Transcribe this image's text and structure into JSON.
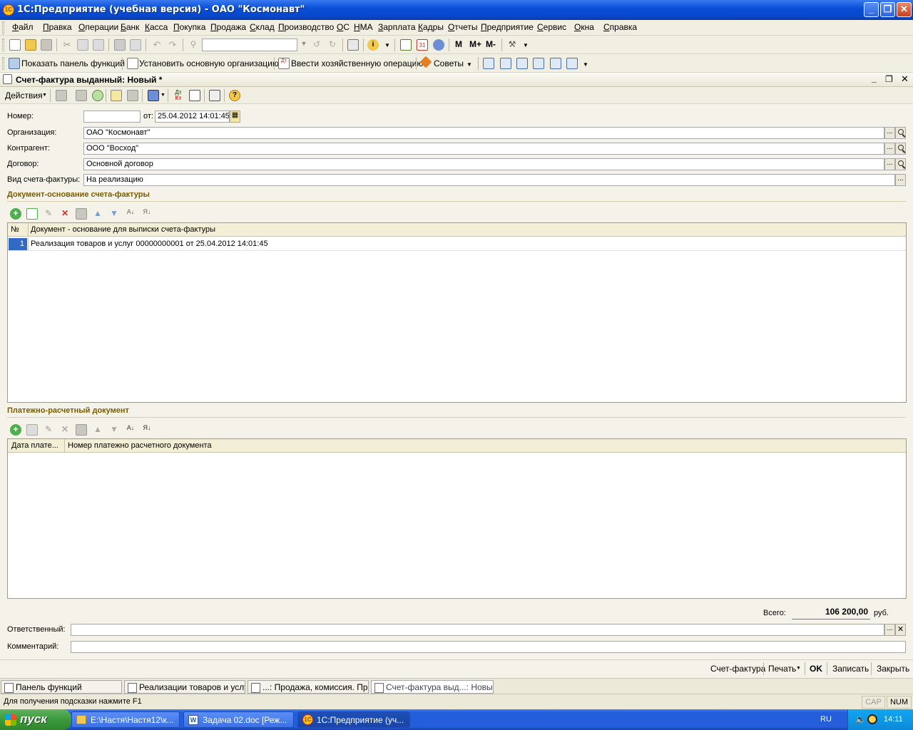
{
  "window": {
    "title": "1С:Предприятие (учебная версия) - ОАО \"Космонавт\""
  },
  "menu": [
    "Файл",
    "Правка",
    "Операции",
    "Банк",
    "Касса",
    "Покупка",
    "Продажа",
    "Склад",
    "Производство",
    "ОС",
    "НМА",
    "Зарплата",
    "Кадры",
    "Отчеты",
    "Предприятие",
    "Сервис",
    "Окна",
    "Справка"
  ],
  "toolbar2": {
    "show_panel": "Показать панель функций",
    "set_org": "Установить основную организацию",
    "enter_op": "Ввести хозяйственную операцию",
    "tips": "Советы",
    "m": "M",
    "mplus": "M+",
    "mminus": "M-"
  },
  "document": {
    "title": "Счет-фактура выданный: Новый *",
    "actions": "Действия",
    "number_label": "Номер:",
    "number_value": "",
    "date_label": "от:",
    "date_value": "25.04.2012 14:01:45",
    "org_label": "Организация:",
    "org_value": "ОАО \"Космонавт\"",
    "contractor_label": "Контрагент:",
    "contractor_value": "ООО \"Восход\"",
    "contract_label": "Договор:",
    "contract_value": "Основной договор",
    "invoice_type_label": "Вид счета-фактуры:",
    "invoice_type_value": "На реализацию",
    "basis_section": "Документ-основание счета-фактуры",
    "basis_table": {
      "col_num": "№",
      "col_doc": "Документ - основание для выписки счета-фактуры",
      "rows": [
        {
          "num": "1",
          "doc": "Реализация товаров и услуг 00000000001 от 25.04.2012 14:01:45"
        }
      ]
    },
    "payment_section": "Платежно-расчетный документ",
    "payment_table": {
      "col_date": "Дата плате...",
      "col_num": "Номер платежно расчетного документа"
    },
    "total_label": "Всего:",
    "total_value": "106 200,00",
    "total_currency": "руб.",
    "responsible_label": "Ответственный:",
    "responsible_value": "",
    "comment_label": "Комментарий:",
    "comment_value": "",
    "btn_invoice": "Счет-фактура",
    "btn_print": "Печать",
    "btn_ok": "OK",
    "btn_save": "Записать",
    "btn_close": "Закрыть"
  },
  "window_tabs": [
    "Панель функций",
    "Реализации товаров и услуг",
    "...: Продажа, комиссия. Пр...",
    "Счет-фактура выд...: Новый *"
  ],
  "status": {
    "hint": "Для получения подсказки нажмите F1",
    "cap": "CAP",
    "num": "NUM"
  },
  "taskbar": {
    "start": "пуск",
    "tasks": [
      "E:\\Настя\\Настя12\\к...",
      "Задача 02.doc [Реж...",
      "1С:Предприятие (уч..."
    ],
    "lang": "RU",
    "clock": "14:11"
  }
}
